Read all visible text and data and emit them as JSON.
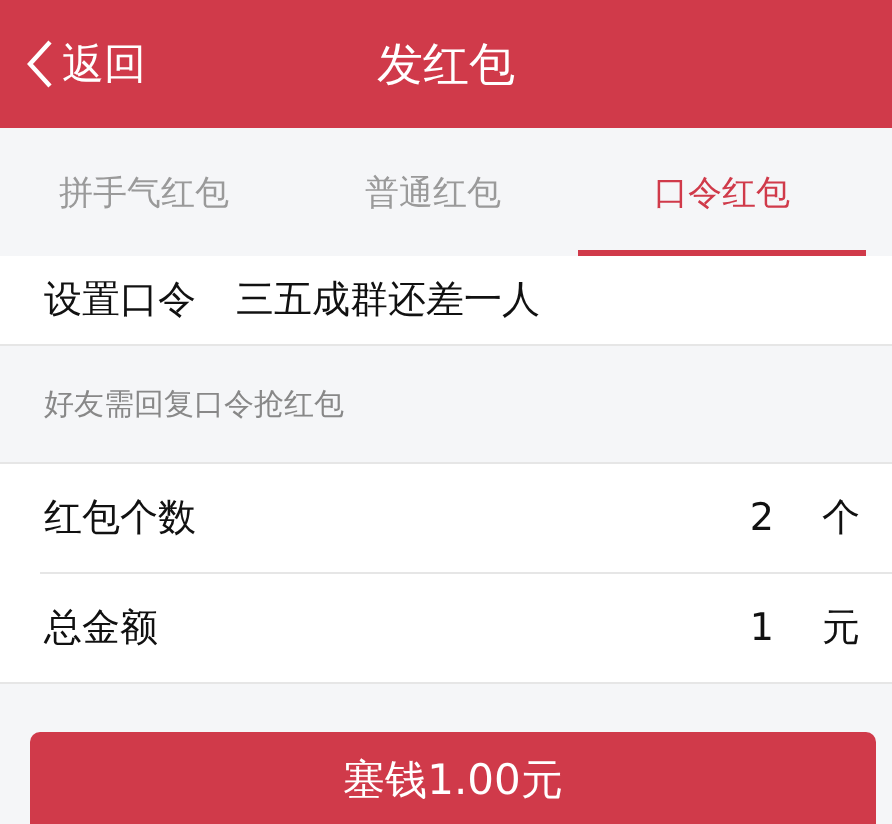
{
  "header": {
    "back": "返回",
    "title": "发红包"
  },
  "tabs": [
    {
      "label": "拼手气红包",
      "selected": false
    },
    {
      "label": "普通红包",
      "selected": false
    },
    {
      "label": "口令红包",
      "selected": true
    }
  ],
  "password": {
    "label": "设置口令",
    "value": "三五成群还差一人"
  },
  "hint": "好友需回复口令抢红包",
  "rows": [
    {
      "label": "红包个数",
      "value": "2",
      "unit": "个"
    },
    {
      "label": "总金额",
      "value": "1",
      "unit": "元"
    }
  ],
  "submit": "塞钱1.00元"
}
